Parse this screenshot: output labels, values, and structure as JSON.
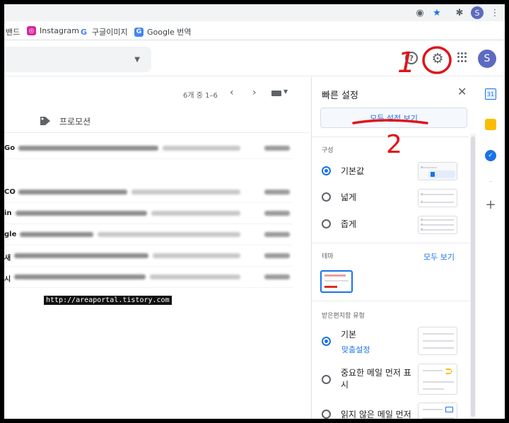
{
  "browser": {
    "profile_initial": "S",
    "bookmarks": [
      {
        "label": "밴드",
        "icon": "band-icon"
      },
      {
        "label": "Instagram",
        "icon": "instagram-icon"
      },
      {
        "label": "구글이미지",
        "icon": "google-icon"
      },
      {
        "label": "Google 번역",
        "icon": "google-translate-icon"
      }
    ]
  },
  "gmail": {
    "account_initial": "S",
    "pager": {
      "text": "6개 중 1–6",
      "prev": "‹",
      "next": "›"
    },
    "tab_label": "프로모션",
    "rows": [
      {
        "sender": "Go"
      },
      {
        "sender": ""
      },
      {
        "sender": "CO"
      },
      {
        "sender": "in"
      },
      {
        "sender": "gle"
      },
      {
        "sender": "새"
      },
      {
        "sender": "시"
      }
    ]
  },
  "quick_settings": {
    "title": "빠른 설정",
    "close": "✕",
    "all_settings_button": "모든 설정 보기",
    "density": {
      "heading": "구성",
      "options": [
        {
          "label": "기본값",
          "selected": true
        },
        {
          "label": "넓게",
          "selected": false
        },
        {
          "label": "좁게",
          "selected": false
        }
      ]
    },
    "theme": {
      "heading": "테마",
      "see_all": "모두 보기"
    },
    "inbox_type": {
      "heading": "받은편지함 유형",
      "options": [
        {
          "label": "기본",
          "selected": true,
          "link": "맞춤설정"
        },
        {
          "label": "중요한 메일 먼저 표시",
          "selected": false
        },
        {
          "label": "읽지 않은 메일 먼저",
          "selected": false
        }
      ]
    }
  },
  "side_apps": {
    "calendar_day": "31",
    "add": "+"
  },
  "annotations": {
    "step1": "1",
    "step2": "2",
    "color": "#e0151b"
  },
  "watermark": "http://areaportal.tistory.com",
  "colors": {
    "accent": "#1a73e8",
    "avatar": "#5c6bc0",
    "annotation": "#e0151b"
  }
}
